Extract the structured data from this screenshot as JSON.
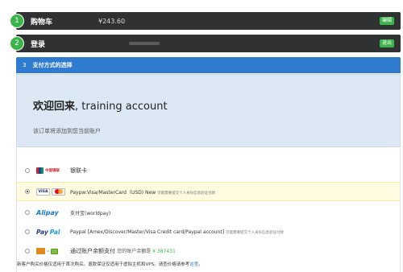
{
  "steps": [
    {
      "number": "1",
      "title": "购物车",
      "value": "¥243.60",
      "action": "编辑"
    },
    {
      "number": "2",
      "title": "登录",
      "value": "",
      "action": "退出"
    },
    {
      "number": "3",
      "title": "支付方式的选择"
    }
  ],
  "welcome": {
    "title_bold": "欢迎回来",
    "title_rest": ", training account",
    "subtitle": "该订单将添加到您当前账户"
  },
  "payment_methods": [
    {
      "logo": "unionpay-logo",
      "logo_text": "中国银联",
      "label": "银联卡",
      "note": "",
      "selected": false
    },
    {
      "logo": "visa-mastercard-logo",
      "logo_text": "VISA",
      "label": "Paypw:Visa/MasterCard（USD) New",
      "note": "可能需要提交个人身份信息验证付款",
      "selected": true
    },
    {
      "logo": "alipay-logo",
      "logo_text": "Alipay",
      "label": "支付宝(worldpay)",
      "note": "",
      "selected": false
    },
    {
      "logo": "paypal-logo",
      "logo_text_a": "Pay",
      "logo_text_b": "Pal",
      "label": "Paypal [Amex/Discover/Master/Visa Credit card/Paypal account]",
      "note": "可能需要提交个人身份信息验证付款",
      "selected": false
    },
    {
      "logo": "wallet-logo",
      "label": "通过账户余额支付",
      "balance_label": "您的账户余额是",
      "balance_amount": "¥ 387431",
      "selected": false
    }
  ],
  "footer": {
    "text": "新客户购买价格仅适用于首次购买。退款保证仅适用于虚拟主机和VPS。请查价格请参考",
    "link": "这里",
    "end": "。"
  }
}
